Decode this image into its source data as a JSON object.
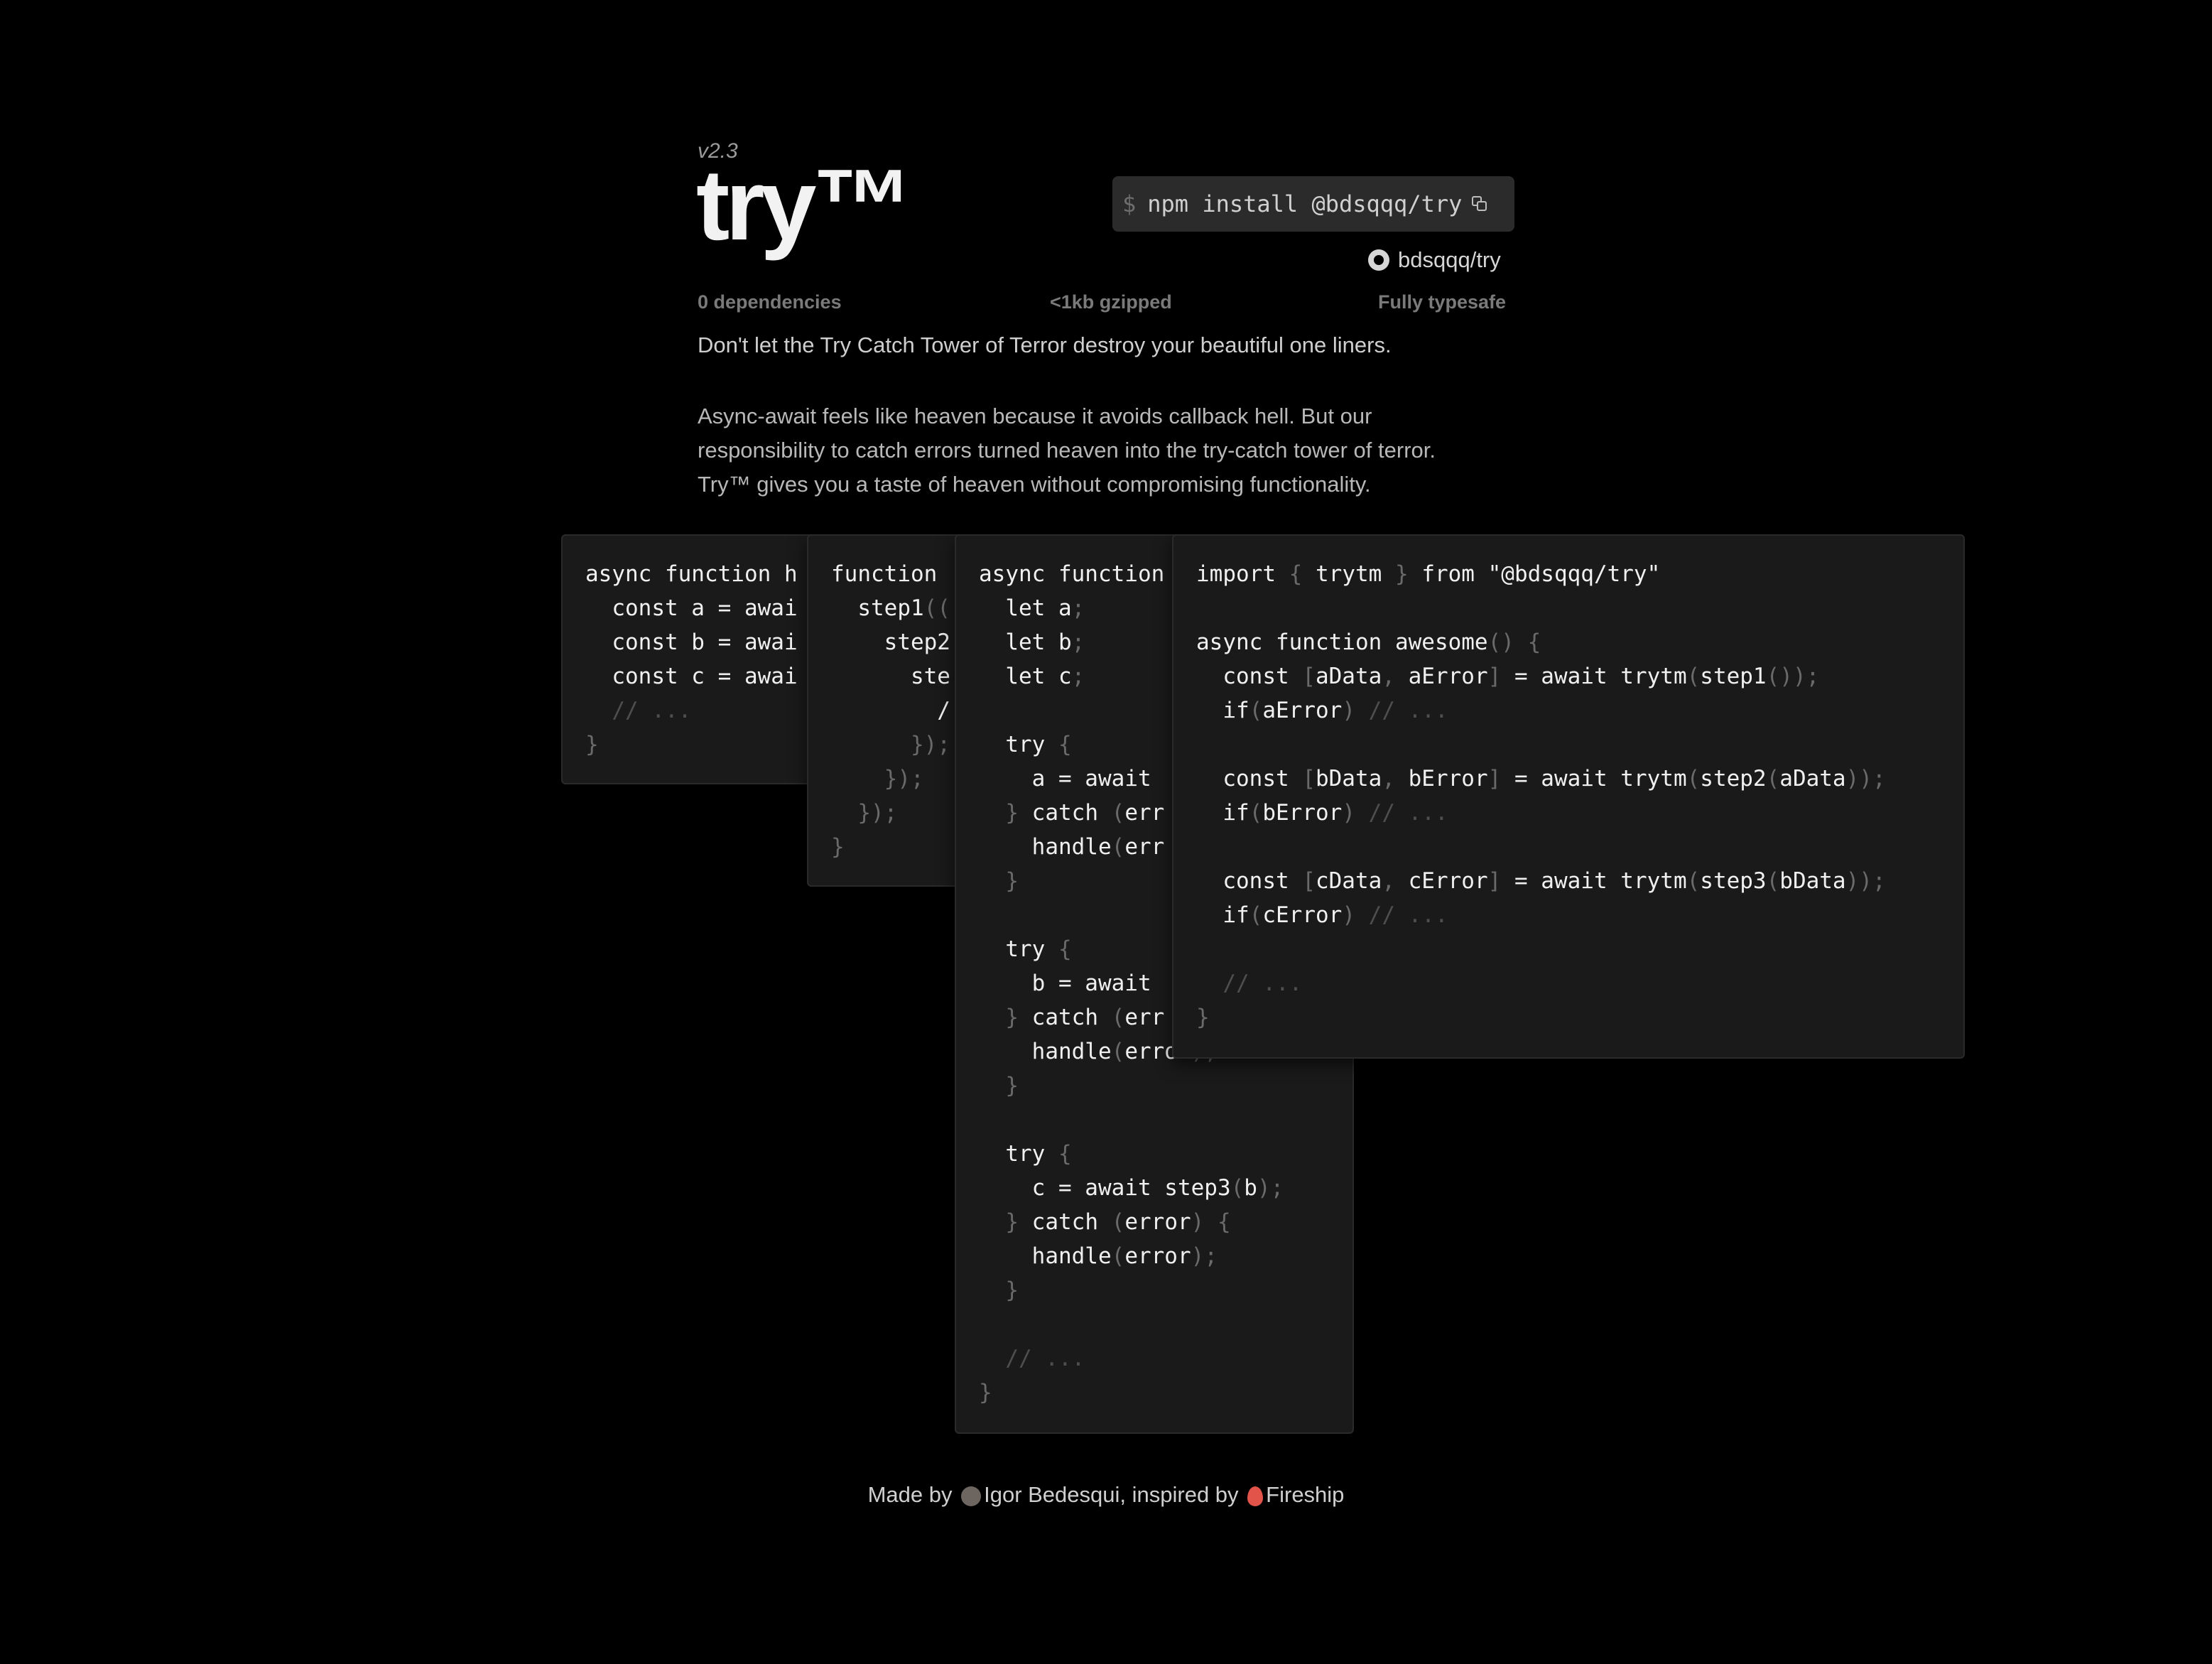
{
  "header": {
    "version": "v2.3",
    "logo": "try™",
    "install_prompt": "$",
    "install_command": "npm install @bdsqqq/try",
    "github_label": "bdsqqq/try"
  },
  "stats": [
    "0 dependencies",
    "<1kb gzipped",
    "Fully typesafe"
  ],
  "intro": {
    "tagline": "Don't let the Try Catch Tower of Terror destroy your beautiful one liners.",
    "description": [
      "Async-await feels like heaven because it avoids callback hell. But our",
      "responsibility to catch errors turned heaven into the try-catch tower of terror.",
      "Try™ gives you a taste of heaven without compromising functionality."
    ]
  },
  "code_cards": [
    {
      "name": "async-await-example",
      "lines": [
        "async function h",
        "  const a = awai",
        "  const b = awai",
        "  const c = awai",
        "  // ...",
        "}"
      ]
    },
    {
      "name": "callback-hell-example",
      "lines": [
        "function",
        "  step1((",
        "    step2",
        "      ste",
        "        /",
        "      });",
        "    });",
        "  });",
        "}"
      ]
    },
    {
      "name": "try-catch-tower-example",
      "lines": [
        "async function",
        "  let a;",
        "  let b;",
        "  let c;",
        "",
        "  try {",
        "    a = await",
        "  } catch (err",
        "    handle(err",
        "  }",
        "",
        "  try {",
        "    b = await",
        "  } catch (err",
        "    handle(error);",
        "  }",
        "",
        "  try {",
        "    c = await step3(b);",
        "  } catch (error) {",
        "    handle(error);",
        "  }",
        "",
        "  // ...",
        "}"
      ]
    },
    {
      "name": "trytm-example",
      "lines": [
        "import { trytm } from \"@bdsqqq/try\"",
        "",
        "async function awesome() {",
        "  const [aData, aError] = await trytm(step1());",
        "  if(aError) // ...",
        "",
        "  const [bData, bError] = await trytm(step2(aData));",
        "  if(bError) // ...",
        "",
        "  const [cData, cError] = await trytm(step3(bData));",
        "  if(cError) // ...",
        "",
        "  // ...",
        "}"
      ]
    }
  ],
  "footer": {
    "made_by": "Made by",
    "author": "Igor Bedesqui",
    "inspired_by": ", inspired by",
    "inspiration": "Fireship"
  }
}
